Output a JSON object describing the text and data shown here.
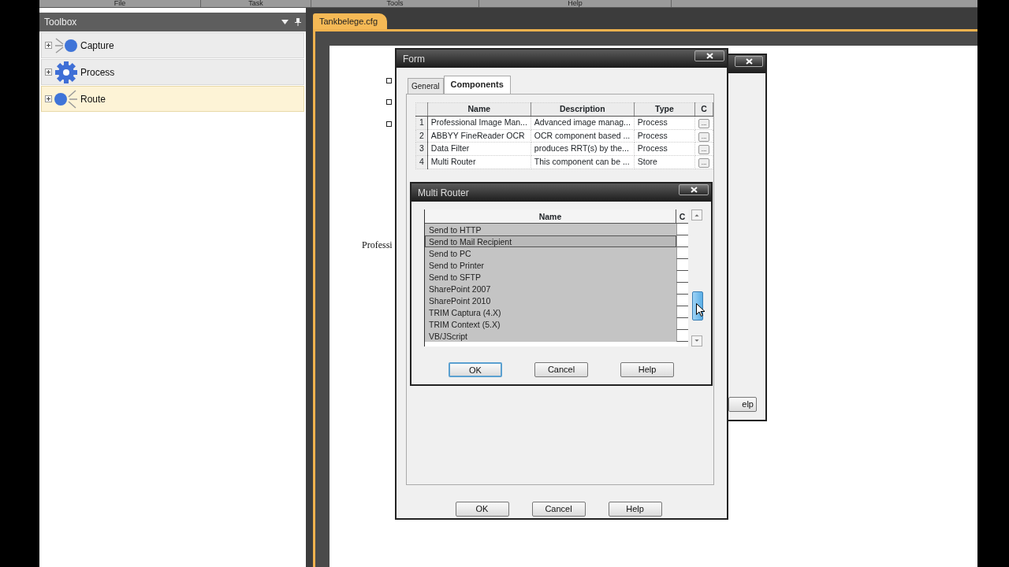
{
  "menu": [
    {
      "label": "File"
    },
    {
      "label": "Task"
    },
    {
      "label": "Tools"
    },
    {
      "label": "Help"
    }
  ],
  "toolbox": {
    "title": "Toolbox",
    "items": [
      {
        "label": "Capture",
        "kind": "capture",
        "expanded": false,
        "selected": false
      },
      {
        "label": "Process",
        "kind": "process",
        "expanded": false,
        "selected": false
      },
      {
        "label": "Route",
        "kind": "route",
        "expanded": false,
        "selected": true
      }
    ]
  },
  "document_tab": {
    "label": "Tankbelege.cfg",
    "selected": true
  },
  "page": {
    "checkboxes": [
      {
        "checked": false
      },
      {
        "checked": false
      },
      {
        "checked": false
      }
    ],
    "text": "Professi"
  },
  "back_dialog": {
    "button": "elp"
  },
  "form": {
    "title": "Form",
    "tabs": [
      {
        "label": "General",
        "selected": false
      },
      {
        "label": "Components",
        "selected": true
      }
    ],
    "columns": [
      "Name",
      "Description",
      "Type",
      "C"
    ],
    "rows": [
      {
        "index": "1",
        "name": "Professional Image Man...",
        "description": "Advanced image manag...",
        "type": "Process",
        "action": "..."
      },
      {
        "index": "2",
        "name": "ABBYY FineReader OCR",
        "description": "OCR component based ...",
        "type": "Process",
        "action": "..."
      },
      {
        "index": "3",
        "name": "Data Filter",
        "description": "produces RRT(s) by the...",
        "type": "Process",
        "action": "..."
      },
      {
        "index": "4",
        "name": "Multi Router",
        "description": "This component can be ...",
        "type": "Store",
        "action": "..."
      }
    ],
    "buttons": [
      {
        "label": "OK",
        "focused": false
      },
      {
        "label": "Cancel",
        "focused": false
      },
      {
        "label": "Help",
        "focused": false
      }
    ]
  },
  "multi_router": {
    "title": "Multi Router",
    "columns": [
      "Name",
      "C"
    ],
    "rows": [
      {
        "name": "Send to HTTP",
        "selected": false,
        "checked": false
      },
      {
        "name": "Send to Mail Recipient",
        "selected": true,
        "checked": false
      },
      {
        "name": "Send to PC",
        "selected": false,
        "checked": false
      },
      {
        "name": "Send to Printer",
        "selected": false,
        "checked": false
      },
      {
        "name": "Send to SFTP",
        "selected": false,
        "checked": false
      },
      {
        "name": "SharePoint 2007",
        "selected": false,
        "checked": false
      },
      {
        "name": "SharePoint 2010",
        "selected": false,
        "checked": false
      },
      {
        "name": "TRIM Captura (4.X)",
        "selected": false,
        "checked": false
      },
      {
        "name": "TRIM Context (5.X)",
        "selected": false,
        "checked": false
      },
      {
        "name": "VB/JScript",
        "selected": false,
        "checked": false
      }
    ],
    "buttons": [
      {
        "label": "OK",
        "focused": true
      },
      {
        "label": "Cancel",
        "focused": false
      },
      {
        "label": "Help",
        "focused": false
      }
    ]
  }
}
